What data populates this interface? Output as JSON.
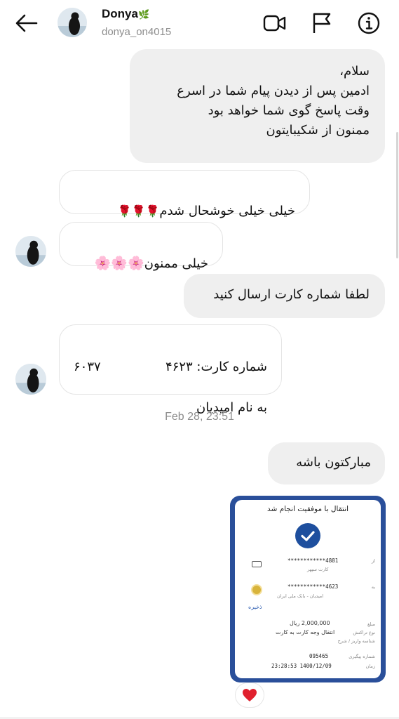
{
  "header": {
    "name": "Donya",
    "name_emoji": "🌿",
    "username": "donya_on4015",
    "icons": [
      "back-arrow-icon",
      "video-call-icon",
      "flag-icon",
      "info-icon"
    ]
  },
  "messages": [
    {
      "side": "outgoing",
      "text": "سلام،\nادمین پس از دیدن پیام شما در اسرع\nوقت پاسخ گوی شما خواهد بود\nممنون از شکیبایتون"
    },
    {
      "side": "incoming",
      "text": "خیلی خیلی خوشحال شدم",
      "emoji": "🌹🌹🌹"
    },
    {
      "side": "incoming",
      "text": "خیلی ممنون",
      "emoji": "🌸🌸🌸"
    },
    {
      "side": "outgoing",
      "text": "لطفا شماره کارت ارسال کنید"
    },
    {
      "side": "incoming",
      "line1": "شماره کارت: ۴۶۲۳",
      "line1_end": "۶۰۳۷",
      "line2": "به نام امیدیان"
    },
    {
      "side": "outgoing",
      "text": "مبارکتون باشه"
    }
  ],
  "timestamp": "Feb 28, 23:51",
  "receipt": {
    "title": "انتقال با موفقیت انجام شد",
    "from_label": "از",
    "from_card": "************4881",
    "from_bank": "کارت سپهر",
    "to_label": "به",
    "to_card": "************4623",
    "to_name": "امیدیان - بانک ملی ایران",
    "save_label": "ذخیره",
    "amount_label": "مبلغ",
    "amount": "2,000,000 ریال",
    "type_label": "نوع تراکنش",
    "type": "انتقال وجه کارت به کارت",
    "desc_label": "شناسه واریز / شرح",
    "tracking_label": "شماره پیگیری",
    "tracking": "095465",
    "time_label": "زمان",
    "time": "23:28:53  1400/12/09"
  },
  "reaction": {
    "icon": "heart-icon",
    "color": "#e0202e"
  },
  "colors": {
    "outgoing_bubble": "#efefef",
    "incoming_border": "#e4e4e4",
    "receipt_frame": "#2a4f9a",
    "muted_text": "#8e8e8e"
  }
}
